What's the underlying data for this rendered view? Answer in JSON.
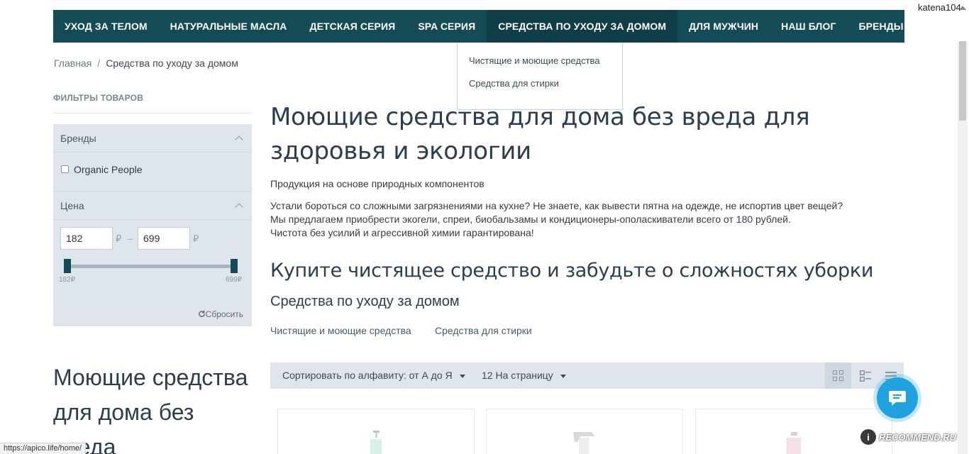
{
  "user": {
    "name": "katena104"
  },
  "nav": {
    "items": [
      "УХОД ЗА ТЕЛОМ",
      "НАТУРАЛЬНЫЕ МАСЛА",
      "ДЕТСКАЯ СЕРИЯ",
      "SPA СЕРИЯ",
      "СРЕДСТВА ПО УХОДУ ЗА ДОМОМ",
      "ДЛЯ МУЖЧИН",
      "НАШ БЛОГ",
      "БРЕНДЫ"
    ],
    "active_index": 4,
    "dropdown": [
      "Чистящие и моющие средства",
      "Средства для стирки"
    ]
  },
  "breadcrumb": {
    "home": "Главная",
    "separator": "/",
    "current": "Средства по уходу за домом"
  },
  "filters": {
    "title": "ФИЛЬТРЫ ТОВАРОВ",
    "brands_label": "Бренды",
    "brand_option": "Organic People",
    "price_label": "Цена",
    "price_min": "182",
    "price_max": "699",
    "currency": "₽",
    "dash": "–",
    "slider_min_label": "182₽",
    "slider_max_label": "699₽",
    "reset_label": "Сбросить"
  },
  "sidebar_heading": "Моющие средства для дома без вреда",
  "main": {
    "title": "Моющие средства для дома без вреда для здоровья и экологии",
    "intro": "Продукция на основе природных компонентов",
    "body_lines": [
      "Устали бороться со сложными загрязнениями на кухне? Не знаете, как вывести пятна на одежде, не испортив цвет вещей?",
      "Мы предлагаем приобрести экогели, спреи, биобальзамы и кондиционеры-ополаскиватели всего от 180 рублей.",
      "Чистота без усилий и агрессивной химии гарантирована!"
    ],
    "subtitle": "Купите чистящее средство и забудьте о сложностях уборки",
    "section_title": "Средства по уходу за домом",
    "categories": [
      "Чистящие и моющие средства",
      "Средства для стирки"
    ]
  },
  "sort": {
    "sort_label": "Сортировать по алфавиту: от А до Я",
    "per_page_label": "12 На страницу"
  },
  "status_url": "https://apico.life/home/",
  "watermark": {
    "mark": "i",
    "text": "RECOMMEND.RU"
  },
  "colors": {
    "nav_bg": "#134b57",
    "filter_bg": "#dfe5ec",
    "chat_button": "#1fa3e0"
  },
  "icons": [
    "chevron-up-icon",
    "reset-icon",
    "grid-view-icon",
    "list-view-icon",
    "rows-view-icon",
    "chat-icon"
  ]
}
